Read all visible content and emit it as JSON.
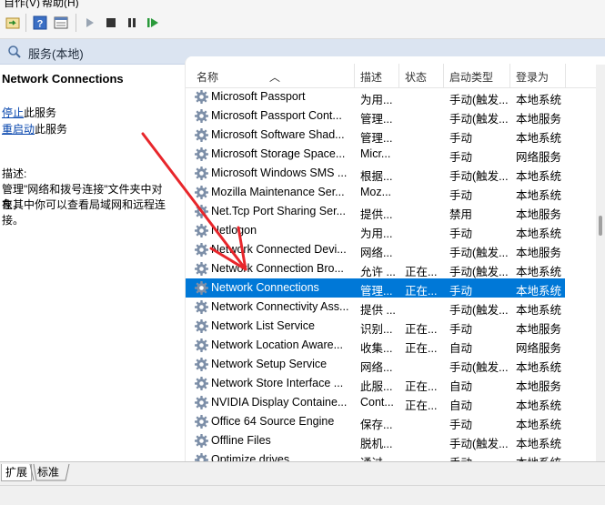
{
  "menubar": {
    "action_label": "自作(V)",
    "help_label": "帮助(H)"
  },
  "header": {
    "title": "服务(本地)"
  },
  "left_pane": {
    "service_title": "Network Connections",
    "stop_link": "停止",
    "stop_suffix": "此服务",
    "restart_link": "重启动",
    "restart_suffix": "此服务",
    "desc_label": "描述:",
    "desc_line1": "管理\"网络和拨号连接\"文件夹中对象，",
    "desc_line2": "在其中你可以查看局域网和远程连",
    "desc_line3": "接。"
  },
  "columns": {
    "name": "名称",
    "desc": "描述",
    "status": "状态",
    "startup": "启动类型",
    "logon": "登录为"
  },
  "services": [
    {
      "name": "Microsoft Passport",
      "desc": "为用...",
      "status": "",
      "startup": "手动(触发...",
      "logon": "本地系统"
    },
    {
      "name": "Microsoft Passport Cont...",
      "desc": "管理...",
      "status": "",
      "startup": "手动(触发...",
      "logon": "本地服务"
    },
    {
      "name": "Microsoft Software Shad...",
      "desc": "管理...",
      "status": "",
      "startup": "手动",
      "logon": "本地系统"
    },
    {
      "name": "Microsoft Storage Space...",
      "desc": "Micr...",
      "status": "",
      "startup": "手动",
      "logon": "网络服务"
    },
    {
      "name": "Microsoft Windows SMS ...",
      "desc": "根据...",
      "status": "",
      "startup": "手动(触发...",
      "logon": "本地系统"
    },
    {
      "name": "Mozilla Maintenance Ser...",
      "desc": "Moz...",
      "status": "",
      "startup": "手动",
      "logon": "本地系统"
    },
    {
      "name": "Net.Tcp Port Sharing Ser...",
      "desc": "提供...",
      "status": "",
      "startup": "禁用",
      "logon": "本地服务"
    },
    {
      "name": "Netlogon",
      "desc": "为用...",
      "status": "",
      "startup": "手动",
      "logon": "本地系统"
    },
    {
      "name": "Network Connected Devi...",
      "desc": "网络...",
      "status": "",
      "startup": "手动(触发...",
      "logon": "本地服务"
    },
    {
      "name": "Network Connection Bro...",
      "desc": "允许 ...",
      "status": "正在...",
      "startup": "手动(触发...",
      "logon": "本地系统"
    },
    {
      "name": "Network Connections",
      "desc": "管理...",
      "status": "正在...",
      "startup": "手动",
      "logon": "本地系统"
    },
    {
      "name": "Network Connectivity Ass...",
      "desc": "提供 ...",
      "status": "",
      "startup": "手动(触发...",
      "logon": "本地系统"
    },
    {
      "name": "Network List Service",
      "desc": "识别...",
      "status": "正在...",
      "startup": "手动",
      "logon": "本地服务"
    },
    {
      "name": "Network Location Aware...",
      "desc": "收集...",
      "status": "正在...",
      "startup": "自动",
      "logon": "网络服务"
    },
    {
      "name": "Network Setup Service",
      "desc": "网络...",
      "status": "",
      "startup": "手动(触发...",
      "logon": "本地系统"
    },
    {
      "name": "Network Store Interface ...",
      "desc": "此服...",
      "status": "正在...",
      "startup": "自动",
      "logon": "本地服务"
    },
    {
      "name": "NVIDIA Display Containe...",
      "desc": "Cont...",
      "status": "正在...",
      "startup": "自动",
      "logon": "本地系统"
    },
    {
      "name": "Office 64 Source Engine",
      "desc": "保存...",
      "status": "",
      "startup": "手动",
      "logon": "本地系统"
    },
    {
      "name": "Offline Files",
      "desc": "脱机...",
      "status": "",
      "startup": "手动(触发...",
      "logon": "本地系统"
    },
    {
      "name": "Optimize drives",
      "desc": "通过...",
      "status": "",
      "startup": "手动",
      "logon": "本地系统"
    }
  ],
  "tabs": {
    "extended": "扩展",
    "standard": "标准"
  },
  "colors": {
    "selection": "#0078d7",
    "arrow": "#e8262b",
    "header_bg": "#dbe4f1"
  }
}
